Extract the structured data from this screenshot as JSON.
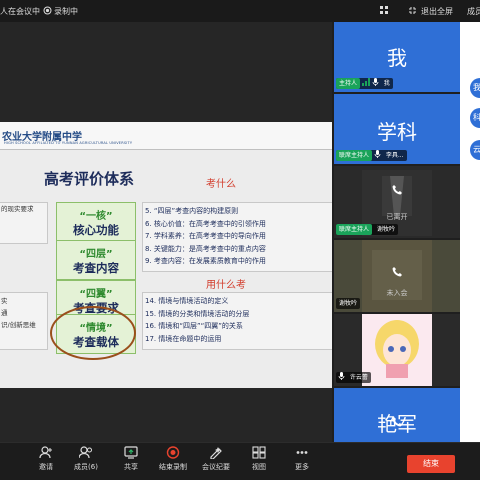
{
  "topbar": {
    "meeting_status": "人在会议中",
    "recording": "录制中",
    "exit_fullscreen": "退出全屏",
    "right_cut": "成员"
  },
  "slide": {
    "school": "农业大学附属中学",
    "school_en": "HIGH SCHOOL AFFILIATED TO YUNNAN AGRICULTURAL UNIVERSITY",
    "title": "高考评价体系",
    "note1": "考什么",
    "note2": "用什么考",
    "left_top": [
      "",
      "",
      "的现实要求"
    ],
    "left_bottom": [
      "实",
      "通",
      "",
      "识/创新思维"
    ],
    "boxes": [
      {
        "a": "“一核”",
        "b": "核心功能"
      },
      {
        "a": "“四层”",
        "b": "考查内容"
      },
      {
        "a": "“四翼”",
        "b": "考查要求"
      },
      {
        "a": "“情境”",
        "b": "考查载体"
      }
    ],
    "list_top": [
      "5. “四层”考查内容的构建原则",
      "6. 核心价值：在高考考查中的引领作用",
      "7. 学科素养：在高考考查中的导向作用",
      "8. 关键能力：是高考考查中的重点内容",
      "9. 考查内容：在发展素质教育中的作用"
    ],
    "list_bottom": [
      "14. 情境与情境活动的定义",
      "15. 情境的分类和情境活动的分层",
      "16. 情境和“四层”“四翼”的关系",
      "17. 情境在命题中的运用"
    ]
  },
  "tiles": [
    {
      "big": "我",
      "role": "主持人",
      "name": "我"
    },
    {
      "big": "学科",
      "role": "联席主持人",
      "name": "李具..."
    },
    {
      "role": "联席主持人",
      "name": "谢牧吟",
      "status": "已离开"
    },
    {
      "name": "谢牧吟",
      "status": "未入会"
    },
    {
      "name": "许云蕾"
    },
    {
      "big": "艳军"
    }
  ],
  "strip": [
    "我",
    "科",
    "云"
  ],
  "toolbar": {
    "items": [
      "邀请",
      "成员(6)",
      "共享",
      "结束录制",
      "会议纪要",
      "视图",
      "更多"
    ],
    "end": "结束"
  },
  "colors": {
    "accent": "#2f6fd6",
    "end": "#e8432e",
    "host": "#1aa35a"
  }
}
